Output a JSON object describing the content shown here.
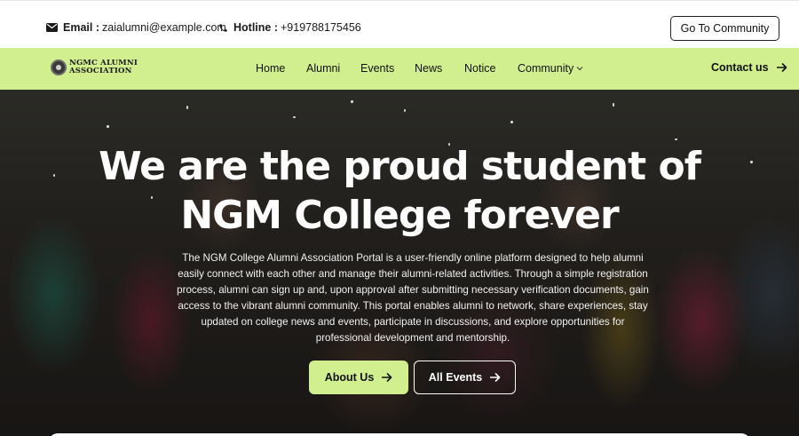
{
  "topbar": {
    "email_label": "Email :",
    "email_value": "zaialumni@example.com",
    "hotline_label": "Hotline :",
    "hotline_value": "+919788175456",
    "community_button": "Go To Community",
    "icons": [
      "envelope-icon",
      "phone-icon"
    ]
  },
  "nav": {
    "logo_line1": "NGMC ALUMNI",
    "logo_line2": "ASSOCIATION",
    "items": [
      {
        "label": "Home"
      },
      {
        "label": "Alumni"
      },
      {
        "label": "Events"
      },
      {
        "label": "News"
      },
      {
        "label": "Notice"
      },
      {
        "label": "Community"
      }
    ],
    "contact_label": "Contact us",
    "background_color": "#d1ef8f"
  },
  "hero": {
    "title_line1": "We are the proud student of",
    "title_line2": "NGM College forever",
    "description": "The NGM College Alumni Association Portal is a user-friendly online platform designed to help alumni easily connect with each other and manage their alumni-related activities. Through a simple registration process, alumni can sign up and, upon approval after submitting necessary verification documents, gain access to the vibrant alumni community. This portal enables alumni to network, share experiences, stay updated on college news and events, participate in discussions, and explore opportunities for professional development and mentorship.",
    "primary_button": "About Us",
    "secondary_button": "All Events",
    "accent_color": "#d1ef8f"
  }
}
